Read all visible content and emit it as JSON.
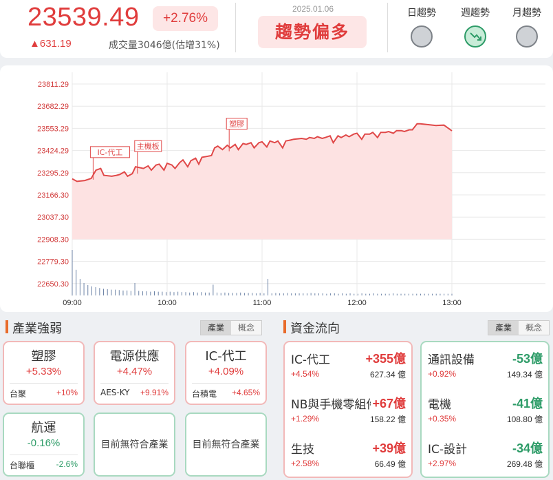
{
  "header": {
    "index_value": "23539.49",
    "change_pct": "+2.76%",
    "change_pts": "▲631.19",
    "volume": "成交量3046億(估增31%)",
    "date": "2025.01.06",
    "trend_verdict": "趨勢偏多",
    "trends": [
      {
        "label": "日趨勢",
        "state": "neutral"
      },
      {
        "label": "週趨勢",
        "state": "down",
        "icon": "trend-down-icon"
      },
      {
        "label": "月趨勢",
        "state": "neutral"
      }
    ]
  },
  "chart_data": {
    "type": "area",
    "y_ticks": [
      "23811.29",
      "23682.29",
      "23553.29",
      "23424.29",
      "23295.29",
      "23166.30",
      "23037.30",
      "22908.30",
      "22779.30",
      "22650.30"
    ],
    "x_ticks": [
      "09:00",
      "10:00",
      "11:00",
      "12:00",
      "13:00"
    ],
    "ylim": [
      22908.3,
      23811.29
    ],
    "x_range_minutes": [
      0,
      270
    ],
    "series": [
      {
        "x": [
          0,
          3,
          8,
          12,
          15,
          18,
          20,
          25,
          28,
          30,
          33,
          35,
          38,
          40,
          45,
          48,
          50,
          53,
          55,
          58,
          60,
          63,
          65,
          68,
          70,
          73,
          75,
          78,
          80,
          82,
          85,
          88,
          90,
          92,
          95,
          98,
          100,
          103,
          105,
          108,
          110,
          113,
          115,
          118,
          120,
          123,
          125,
          128,
          130,
          133,
          135,
          138,
          140,
          145,
          148,
          150,
          153,
          155,
          158,
          160,
          163,
          165,
          168,
          170,
          173,
          175,
          178,
          180,
          183,
          185,
          188,
          190,
          193,
          195,
          198,
          200,
          203,
          205,
          208,
          210,
          213,
          215,
          218,
          220,
          225,
          230,
          235,
          240
        ],
        "y": [
          23260,
          23245,
          23250,
          23262,
          23310,
          23320,
          23280,
          23275,
          23280,
          23285,
          23300,
          23275,
          23290,
          23330,
          23320,
          23335,
          23310,
          23340,
          23345,
          23310,
          23350,
          23340,
          23320,
          23355,
          23370,
          23330,
          23365,
          23380,
          23345,
          23385,
          23390,
          23395,
          23440,
          23450,
          23430,
          23455,
          23440,
          23460,
          23430,
          23465,
          23460,
          23470,
          23440,
          23470,
          23475,
          23445,
          23480,
          23470,
          23480,
          23440,
          23480,
          23485,
          23490,
          23495,
          23490,
          23500,
          23495,
          23505,
          23495,
          23500,
          23510,
          23470,
          23510,
          23500,
          23515,
          23505,
          23520,
          23525,
          23490,
          23520,
          23520,
          23530,
          23500,
          23530,
          23530,
          23535,
          23525,
          23540,
          23540,
          23535,
          23545,
          23545,
          23580,
          23580,
          23575,
          23570,
          23572,
          23539
        ]
      }
    ],
    "annotations": [
      {
        "label": "IC-代工",
        "x": 8,
        "y": 23255
      },
      {
        "label": "主機板",
        "x": 36,
        "y": 23290
      },
      {
        "label": "塑膠",
        "x": 94,
        "y": 23420
      }
    ],
    "volume_bars": [
      110,
      62,
      40,
      30,
      25,
      22,
      20,
      18,
      16,
      15,
      14,
      14,
      13,
      12,
      12,
      11,
      30,
      11,
      10,
      10,
      9,
      10,
      9,
      9,
      8,
      9,
      8,
      9,
      8,
      8,
      7,
      8,
      7,
      8,
      7,
      7,
      26,
      7,
      6,
      7,
      6,
      6,
      6,
      7,
      6,
      6,
      6,
      5,
      6,
      5,
      40,
      5,
      6,
      5,
      5,
      6,
      5,
      5,
      5,
      5,
      5,
      6,
      5,
      5,
      5,
      4,
      5,
      5,
      4,
      5,
      4,
      5,
      4,
      4,
      5,
      4,
      4,
      5,
      4,
      4,
      4,
      4,
      5,
      4,
      4,
      4,
      4,
      4,
      4,
      4,
      4,
      4,
      4,
      4,
      4,
      4,
      4,
      4
    ],
    "grid": true,
    "colors": {
      "line": "#e04848",
      "fill": "#fde2e2",
      "volume": "#6c83a6",
      "grid": "#e8e8e8"
    }
  },
  "industry": {
    "title": "產業強弱",
    "tabs": [
      "產業",
      "概念"
    ],
    "cards": [
      {
        "name": "塑膠",
        "pct": "+5.33%",
        "stock": "台聚",
        "stock_pct": "+10%",
        "tone": "red"
      },
      {
        "name": "電源供應",
        "pct": "+4.47%",
        "stock": "AES-KY",
        "stock_pct": "+9.91%",
        "tone": "red"
      },
      {
        "name": "IC-代工",
        "pct": "+4.09%",
        "stock": "台積電",
        "stock_pct": "+4.65%",
        "tone": "red"
      },
      {
        "name": "航運",
        "pct": "-0.16%",
        "stock": "台聯櫃",
        "stock_pct": "-2.6%",
        "tone": "green"
      }
    ],
    "empty_label": "目前無符合產業"
  },
  "flow": {
    "title": "資金流向",
    "tabs": [
      "產業",
      "概念"
    ],
    "inflow": [
      {
        "name": "IC-代工",
        "amount": "+355億",
        "pct": "+4.54%",
        "volume": "627.34 億"
      },
      {
        "name": "NB與手機零組件",
        "amount": "+67億",
        "pct": "+1.29%",
        "volume": "158.22 億"
      },
      {
        "name": "生技",
        "amount": "+39億",
        "pct": "+2.58%",
        "volume": "66.49 億"
      }
    ],
    "outflow": [
      {
        "name": "通訊設備",
        "amount": "-53億",
        "pct": "+0.92%",
        "volume": "149.34 億"
      },
      {
        "name": "電機",
        "amount": "-41億",
        "pct": "+0.35%",
        "volume": "108.80 億"
      },
      {
        "name": "IC-設計",
        "amount": "-34億",
        "pct": "+2.97%",
        "volume": "269.48 億"
      }
    ]
  }
}
